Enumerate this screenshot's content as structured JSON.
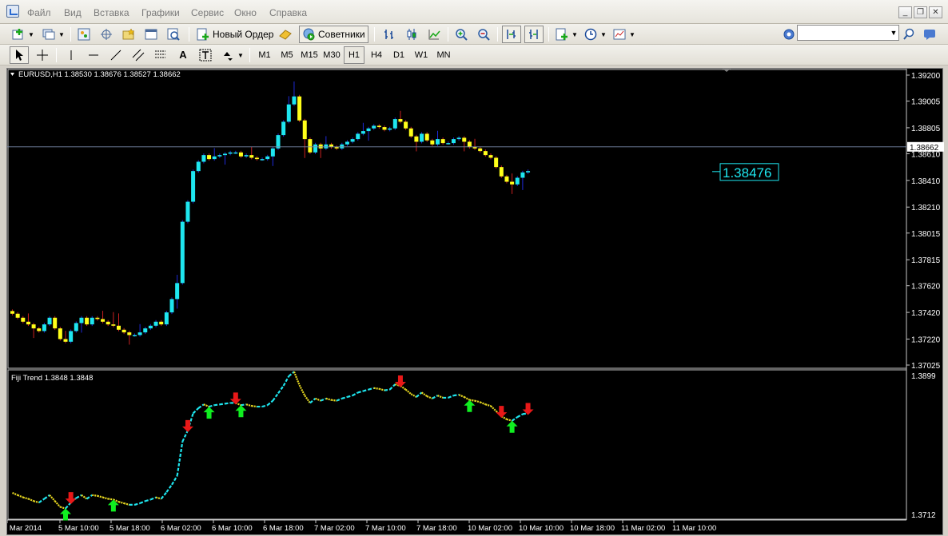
{
  "menu": {
    "items": [
      "Файл",
      "Вид",
      "Вставка",
      "Графики",
      "Сервис",
      "Окно",
      "Справка"
    ]
  },
  "toolbar": {
    "new_order_label": "Новый Ордер",
    "advisors_label": "Советники",
    "search_placeholder": ""
  },
  "timeframes": [
    "M1",
    "M5",
    "M15",
    "M30",
    "H1",
    "H4",
    "D1",
    "W1",
    "MN"
  ],
  "active_timeframe": "H1",
  "main_chart": {
    "header": "EURUSD,H1  1.38530 1.38676 1.38527 1.38662",
    "current_price_label": "1.38662",
    "callout_value": "1.38476",
    "price_ticks": [
      "1.39200",
      "1.39005",
      "1.38805",
      "1.38610",
      "1.38410",
      "1.38210",
      "1.38015",
      "1.37815",
      "1.37620",
      "1.37420",
      "1.37220",
      "1.37025"
    ]
  },
  "indicator": {
    "header": "Fiji Trend 1.3848 1.3848",
    "top_tick": "1.3899",
    "bottom_tick": "1.3712"
  },
  "time_axis": [
    "5 Mar 2014",
    "5 Mar 10:00",
    "5 Mar 18:00",
    "6 Mar 02:00",
    "6 Mar 10:00",
    "6 Mar 18:00",
    "7 Mar 02:00",
    "7 Mar 10:00",
    "7 Mar 18:00",
    "10 Mar 02:00",
    "10 Mar 10:00",
    "10 Mar 18:00",
    "11 Mar 02:00",
    "11 Mar 10:00"
  ],
  "colors": {
    "bull": "#1ee6ef",
    "bear": "#ffff19",
    "wick": "#1e2ad8",
    "wick_bear": "#c82020",
    "arrow_up": "#10ee20",
    "arrow_down": "#e81818",
    "trend_up": "#1ee6ef",
    "trend_down": "#e8d820"
  },
  "chart_data": {
    "type": "candlestick",
    "symbol": "EURUSD",
    "timeframe": "H1",
    "ylim": [
      1.37025,
      1.392
    ],
    "closes": [
      1.3741,
      1.3738,
      1.3735,
      1.3733,
      1.373,
      1.3728,
      1.3733,
      1.3738,
      1.373,
      1.3722,
      1.372,
      1.3728,
      1.3734,
      1.3738,
      1.3733,
      1.3738,
      1.3737,
      1.3735,
      1.3733,
      1.3732,
      1.3729,
      1.3727,
      1.3725,
      1.3725,
      1.3727,
      1.373,
      1.3732,
      1.3735,
      1.3733,
      1.3742,
      1.3752,
      1.3764,
      1.381,
      1.3825,
      1.3848,
      1.3855,
      1.386,
      1.3857,
      1.3859,
      1.386,
      1.3861,
      1.3862,
      1.3862,
      1.3859,
      1.386,
      1.3858,
      1.3857,
      1.3857,
      1.3859,
      1.3865,
      1.3875,
      1.3885,
      1.3898,
      1.3904,
      1.3886,
      1.3872,
      1.3862,
      1.3868,
      1.3865,
      1.3868,
      1.3866,
      1.3865,
      1.3868,
      1.387,
      1.3872,
      1.3876,
      1.3878,
      1.388,
      1.3882,
      1.3881,
      1.3879,
      1.388,
      1.3887,
      1.3885,
      1.388,
      1.3874,
      1.387,
      1.3876,
      1.3871,
      1.3868,
      1.3872,
      1.3869,
      1.3869,
      1.3872,
      1.3873,
      1.387,
      1.3866,
      1.3865,
      1.3863,
      1.386,
      1.3858,
      1.3851,
      1.3844,
      1.384,
      1.3838,
      1.3843,
      1.3847,
      1.3848
    ]
  }
}
